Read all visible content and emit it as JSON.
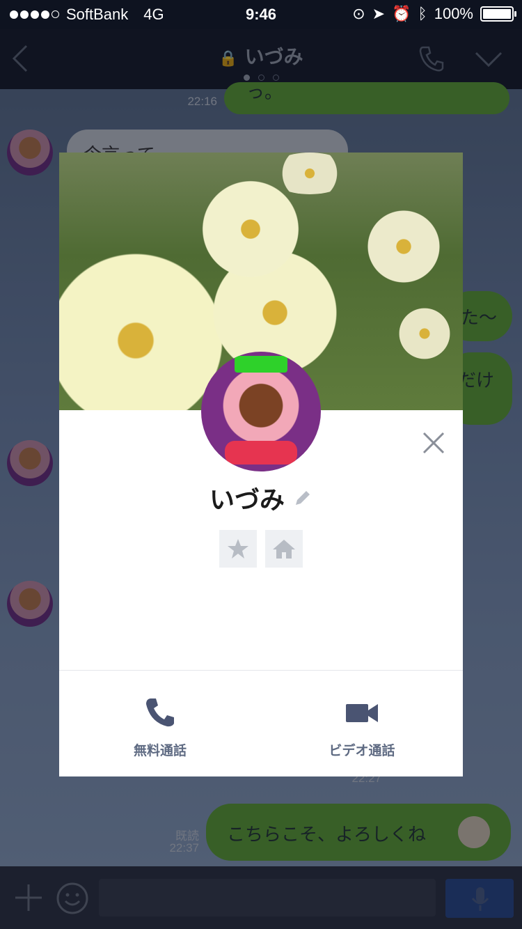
{
  "status_bar": {
    "carrier": "SoftBank",
    "network": "4G",
    "time": "9:46",
    "battery": "100%",
    "battery_level": 1.0
  },
  "nav": {
    "title": "いづみ",
    "page_dots": 3,
    "active_page": 1
  },
  "chat": {
    "messages": [
      {
        "side": "right",
        "text": "っ。",
        "time": "22:16"
      },
      {
        "side": "left",
        "text": "今言って"
      },
      {
        "side": "right",
        "text": "た〜"
      },
      {
        "side": "right",
        "text": "だけ"
      },
      {
        "side": "left",
        "time": "22:27"
      },
      {
        "side": "right",
        "text": "こちらこそ、よろしくね",
        "read": "既読",
        "time": "22:37"
      }
    ]
  },
  "profile": {
    "name": "いづみ",
    "actions": [
      {
        "label": "無料通話",
        "icon": "phone-icon"
      },
      {
        "label": "ビデオ通話",
        "icon": "video-camera-icon"
      }
    ]
  },
  "colors": {
    "green_bubble": "#5da334",
    "send_button": "#27478a",
    "action_text": "#5e6a82"
  }
}
